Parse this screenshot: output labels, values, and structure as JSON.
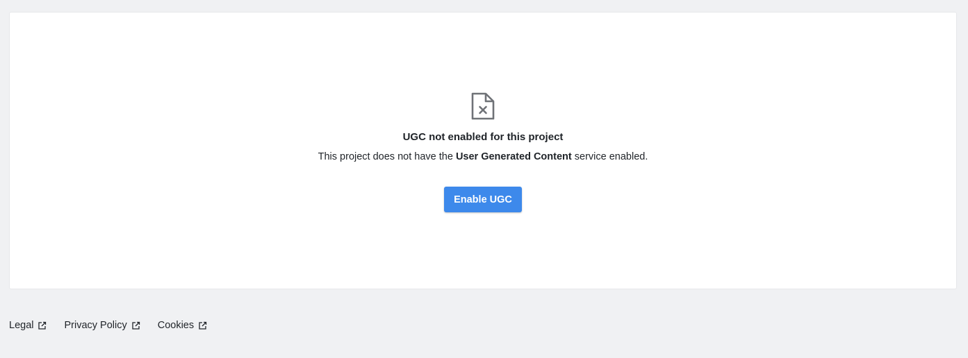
{
  "empty_state": {
    "icon": "file-x-icon",
    "title": "UGC not enabled for this project",
    "description_prefix": "This project does not have the ",
    "description_emphasis": "User Generated Content",
    "description_suffix": " service enabled.",
    "button_label": "Enable UGC",
    "button_color": "#3d89eb"
  },
  "footer": {
    "links": [
      {
        "label": "Legal",
        "icon": "external-link-icon"
      },
      {
        "label": "Privacy Policy",
        "icon": "external-link-icon"
      },
      {
        "label": "Cookies",
        "icon": "external-link-icon"
      }
    ]
  }
}
